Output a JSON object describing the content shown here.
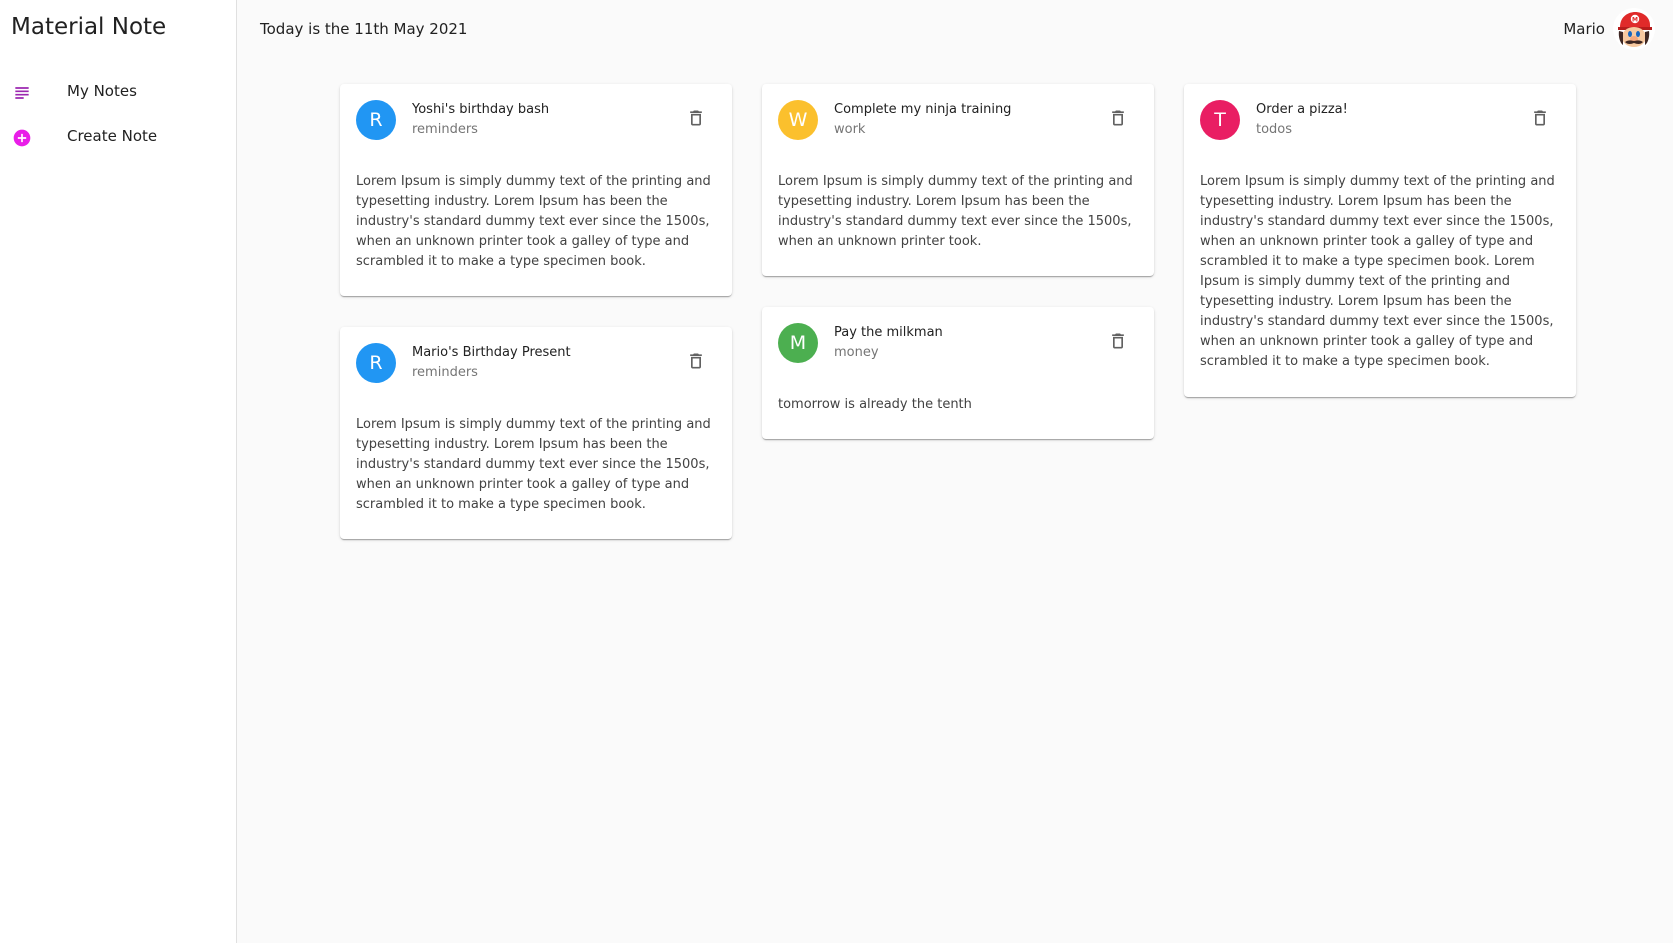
{
  "app": {
    "title": "Material Note"
  },
  "sidebar": {
    "items": [
      {
        "label": "My Notes",
        "icon": "subject-icon",
        "color": "#9c27b0"
      },
      {
        "label": "Create Note",
        "icon": "add-circle-icon",
        "color": "#e91ee8"
      }
    ]
  },
  "header": {
    "date_text": "Today is the 11th May 2021",
    "user_name": "Mario",
    "avatar": "mario-avatar"
  },
  "notes": [
    {
      "avatar_letter": "R",
      "avatar_color": "#2196f3",
      "title": "Yoshi's birthday bash",
      "category": "reminders",
      "details": "Lorem Ipsum is simply dummy text of the printing and typesetting industry. Lorem Ipsum has been the industry's standard dummy text ever since the 1500s, when an unknown printer took a galley of type and scrambled it to make a type specimen book."
    },
    {
      "avatar_letter": "W",
      "avatar_color": "#fbc02d",
      "title": "Complete my ninja training",
      "category": "work",
      "details": "Lorem Ipsum is simply dummy text of the printing and typesetting industry. Lorem Ipsum has been the industry's standard dummy text ever since the 1500s, when an unknown printer took."
    },
    {
      "avatar_letter": "T",
      "avatar_color": "#e91e63",
      "title": "Order a pizza!",
      "category": "todos",
      "details": "Lorem Ipsum is simply dummy text of the printing and typesetting industry. Lorem Ipsum has been the industry's standard dummy text ever since the 1500s, when an unknown printer took a galley of type and scrambled it to make a type specimen book. Lorem Ipsum is simply dummy text of the printing and typesetting industry. Lorem Ipsum has been the industry's standard dummy text ever since the 1500s, when an unknown printer took a galley of type and scrambled it to make a type specimen book."
    },
    {
      "avatar_letter": "R",
      "avatar_color": "#2196f3",
      "title": "Mario's Birthday Present",
      "category": "reminders",
      "details": "Lorem Ipsum is simply dummy text of the printing and typesetting industry. Lorem Ipsum has been the industry's standard dummy text ever since the 1500s, when an unknown printer took a galley of type and scrambled it to make a type specimen book."
    },
    {
      "avatar_letter": "M",
      "avatar_color": "#4caf50",
      "title": "Pay the milkman",
      "category": "money",
      "details": "tomorrow is already the tenth"
    }
  ],
  "icons": {
    "delete": "delete-outline-icon"
  }
}
